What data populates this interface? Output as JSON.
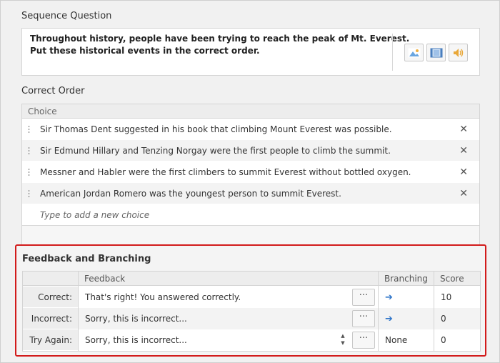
{
  "sequence": {
    "title": "Sequence Question",
    "question_line1": "Throughout history, people have been trying to reach the peak of Mt. Everest.",
    "question_line2": "Put these historical events in the correct order.",
    "media_buttons": [
      {
        "icon": "image-icon"
      },
      {
        "icon": "video-icon"
      },
      {
        "icon": "audio-icon"
      }
    ]
  },
  "correct_order": {
    "title": "Correct Order",
    "column_header": "Choice",
    "choices": [
      "Sir Thomas Dent suggested in his book that climbing Mount Everest was possible.",
      "Sir Edmund Hillary and Tenzing Norgay were the first people to climb the summit.",
      "Messner and Habler were the first climbers to summit Everest without bottled oxygen.",
      "American Jordan Romero was the youngest person to summit Everest."
    ],
    "remove_symbol": "✕",
    "add_placeholder": "Type to add a new choice"
  },
  "feedback": {
    "title": "Feedback and Branching",
    "headers": {
      "feedback": "Feedback",
      "branching": "Branching",
      "score": "Score"
    },
    "dots_label": "···",
    "rows": [
      {
        "label": "Correct:",
        "feedback": "That's right! You answered correctly.",
        "branching": "➔",
        "score": "10"
      },
      {
        "label": "Incorrect:",
        "feedback": "Sorry, this is incorrect...",
        "branching": "➔",
        "score": "0"
      },
      {
        "label": "Try Again:",
        "feedback": "Sorry, this is incorrect...",
        "branching": "None",
        "score": "0"
      }
    ],
    "spinner_up": "▲",
    "spinner_down": "▼"
  },
  "colors": {
    "highlight": "#d21b1b",
    "arrow": "#2f75c9"
  }
}
